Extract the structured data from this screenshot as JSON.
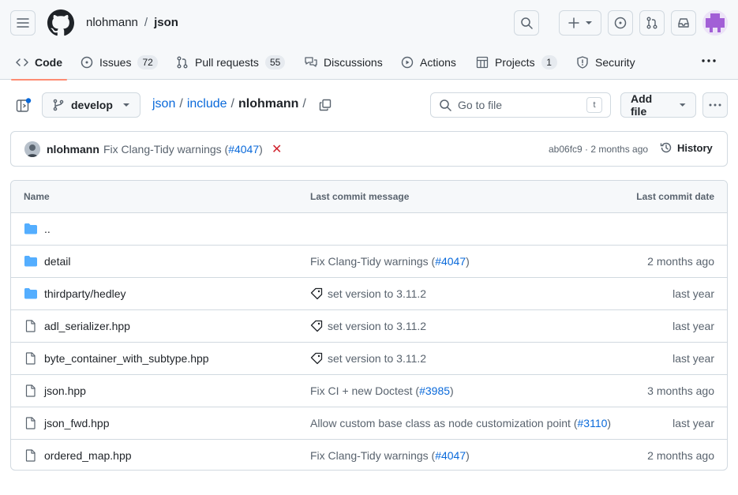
{
  "header": {
    "owner": "nlohmann",
    "separator": "/",
    "repo": "json"
  },
  "nav": {
    "code": "Code",
    "issues": "Issues",
    "issues_count": "72",
    "pulls": "Pull requests",
    "pulls_count": "55",
    "discussions": "Discussions",
    "actions": "Actions",
    "projects": "Projects",
    "projects_count": "1",
    "security": "Security"
  },
  "toolbar": {
    "branch": "develop",
    "breadcrumb": [
      "json",
      "include",
      "nlohmann"
    ],
    "goto_placeholder": "Go to file",
    "goto_shortcut": "t",
    "add_file": "Add file"
  },
  "latest_commit": {
    "author": "nlohmann",
    "message_prefix": "Fix Clang-Tidy warnings (",
    "pr": "#4047",
    "message_suffix": ")",
    "status": "✕",
    "meta": "ab06fc9 · 2 months ago",
    "history": "History"
  },
  "table": {
    "headers": {
      "name": "Name",
      "message": "Last commit message",
      "date": "Last commit date"
    },
    "rows": [
      {
        "type": "dir",
        "name": "..",
        "msg_pre": "",
        "pr": "",
        "msg_post": "",
        "date": "",
        "tag": false
      },
      {
        "type": "dir",
        "name": "detail",
        "msg_pre": "Fix Clang-Tidy warnings (",
        "pr": "#4047",
        "msg_post": ")",
        "date": "2 months ago",
        "tag": false
      },
      {
        "type": "dir",
        "name": "thirdparty/hedley",
        "msg_pre": "set version to 3.11.2",
        "pr": "",
        "msg_post": "",
        "date": "last year",
        "tag": true
      },
      {
        "type": "file",
        "name": "adl_serializer.hpp",
        "msg_pre": "set version to 3.11.2",
        "pr": "",
        "msg_post": "",
        "date": "last year",
        "tag": true
      },
      {
        "type": "file",
        "name": "byte_container_with_subtype.hpp",
        "msg_pre": "set version to 3.11.2",
        "pr": "",
        "msg_post": "",
        "date": "last year",
        "tag": true
      },
      {
        "type": "file",
        "name": "json.hpp",
        "msg_pre": "Fix CI + new Doctest (",
        "pr": "#3985",
        "msg_post": ")",
        "date": "3 months ago",
        "tag": false
      },
      {
        "type": "file",
        "name": "json_fwd.hpp",
        "msg_pre": "Allow custom base class as node customization point (",
        "pr": "#3110",
        "msg_post": ")",
        "date": "last year",
        "tag": false
      },
      {
        "type": "file",
        "name": "ordered_map.hpp",
        "msg_pre": "Fix Clang-Tidy warnings (",
        "pr": "#4047",
        "msg_post": ")",
        "date": "2 months ago",
        "tag": false
      }
    ]
  }
}
